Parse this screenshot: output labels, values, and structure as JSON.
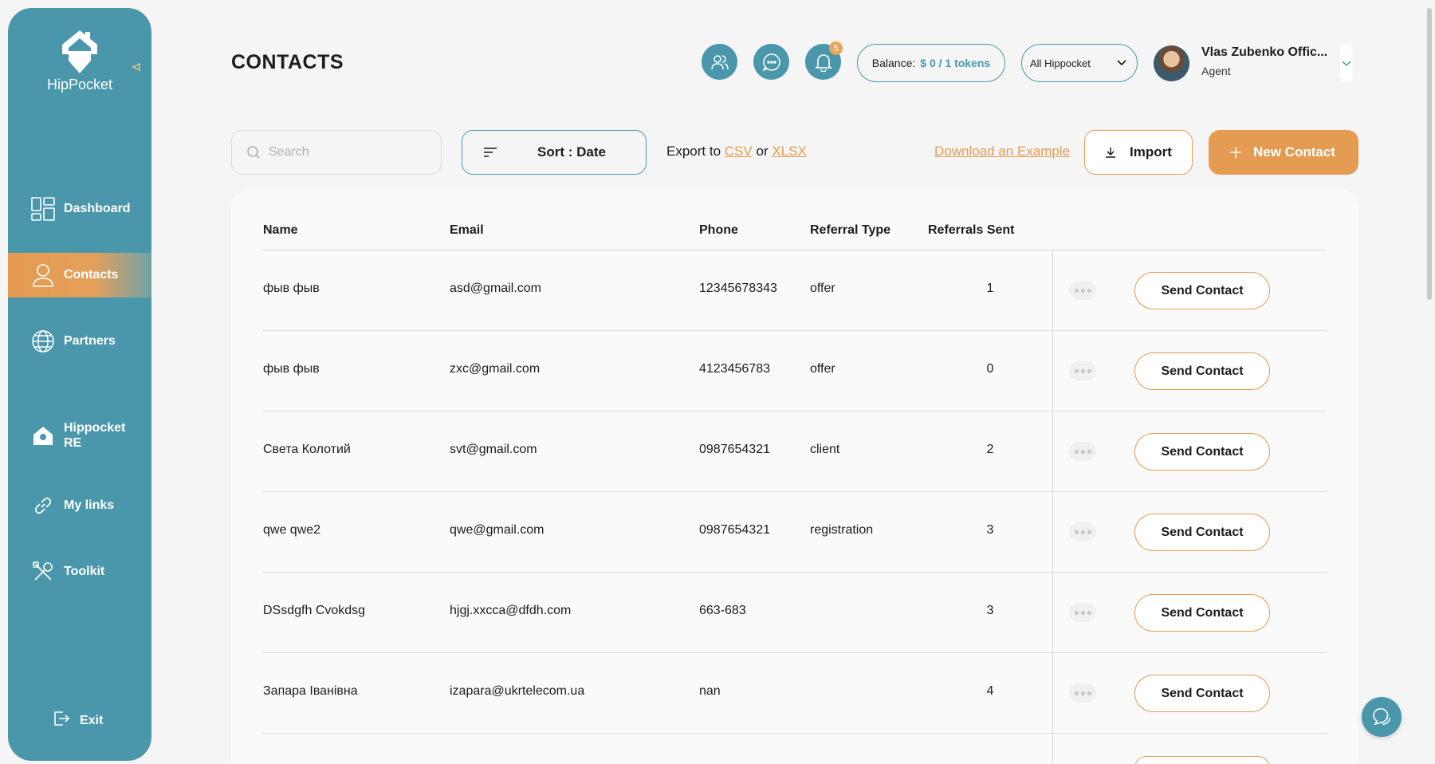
{
  "app": {
    "logo_text": "HipPocket"
  },
  "sidebar": {
    "items": [
      {
        "label": "Dashboard",
        "icon": "dashboard-icon"
      },
      {
        "label": "Contacts",
        "icon": "user-icon",
        "active": true
      },
      {
        "label": "Partners",
        "icon": "globe-users-icon"
      },
      {
        "label": "Hippocket RE",
        "icon": "home-location-icon"
      },
      {
        "label": "My links",
        "icon": "link-icon"
      },
      {
        "label": "Toolkit",
        "icon": "tools-icon"
      }
    ],
    "exit_label": "Exit"
  },
  "header": {
    "title": "CONTACTS",
    "notifications_count": "5",
    "balance_label": "Balance:",
    "balance_value": "$ 0 / 1 tokens",
    "workspace": "All Hippocket",
    "user_name": "Vlas Zubenko Offic...",
    "user_role": "Agent"
  },
  "toolbar": {
    "search_placeholder": "Search",
    "sort_label": "Sort : Date",
    "export_prefix": "Export to",
    "export_csv": "CSV",
    "export_or": "or",
    "export_xlsx": "XLSX",
    "download_example": "Download an Example",
    "import_label": "Import",
    "new_contact_label": "New Contact"
  },
  "table": {
    "columns": [
      "Name",
      "Email",
      "Phone",
      "Referral Type",
      "Referrals Sent"
    ],
    "send_label": "Send Contact",
    "rows": [
      {
        "name": "фыв фыв",
        "email": "asd@gmail.com",
        "phone": "12345678343",
        "type": "offer",
        "sent": "1"
      },
      {
        "name": "фыв фыв",
        "email": "zxc@gmail.com",
        "phone": "4123456783",
        "type": "offer",
        "sent": "0"
      },
      {
        "name": "Света Колотий",
        "email": "svt@gmail.com",
        "phone": "0987654321",
        "type": "client",
        "sent": "2"
      },
      {
        "name": "qwe qwe2",
        "email": "qwe@gmail.com",
        "phone": "0987654321",
        "type": "registration",
        "sent": "3"
      },
      {
        "name": "DSsdgfh Cvokdsg",
        "email": "hjgj.xxcca@dfdh.com",
        "phone": "663-683",
        "type": "",
        "sent": "3"
      },
      {
        "name": "Запара Іванівна",
        "email": "izapara@ukrtelecom.ua",
        "phone": "nan",
        "type": "",
        "sent": "4"
      }
    ]
  },
  "colors": {
    "teal": "#4a97ab",
    "orange": "#e59b51"
  }
}
